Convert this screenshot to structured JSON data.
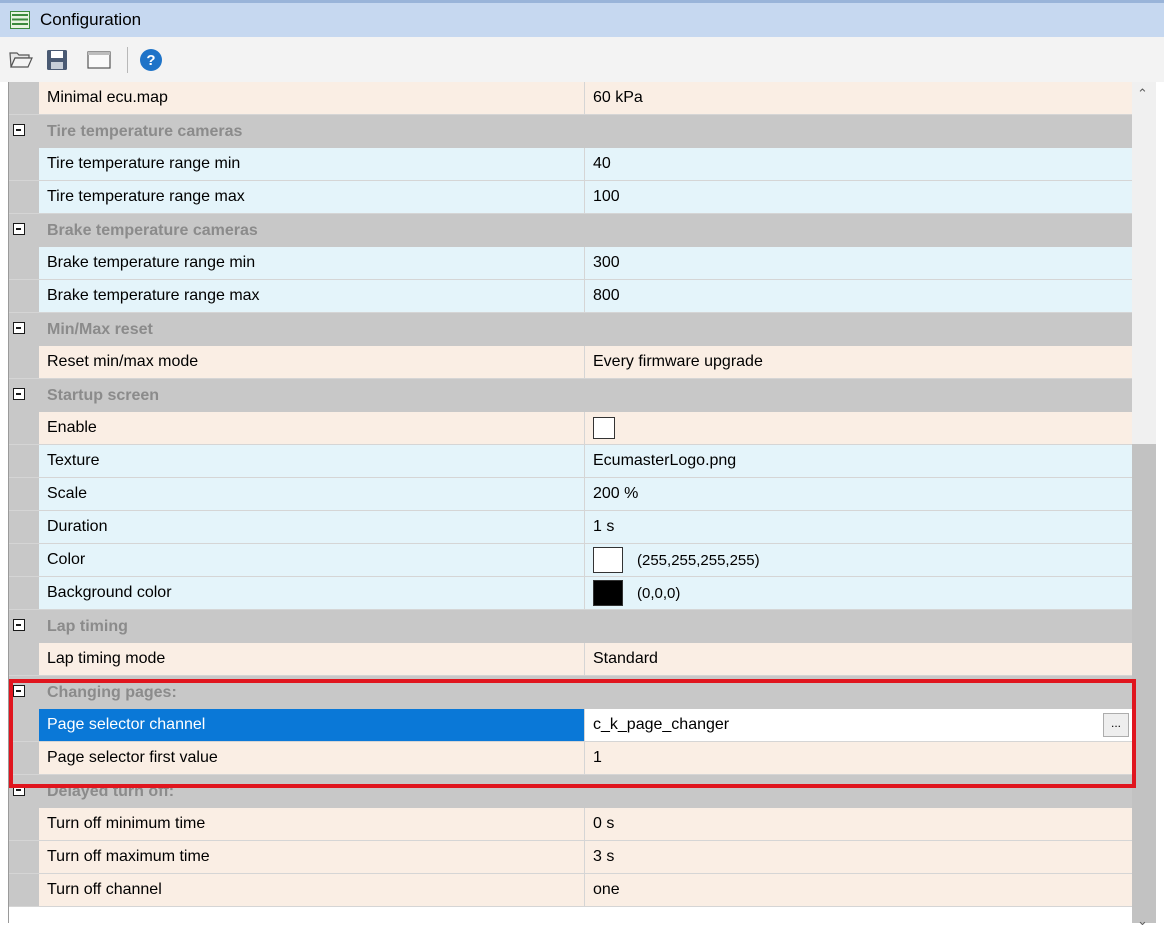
{
  "window": {
    "title": "Configuration"
  },
  "toolbar": {
    "buttons": [
      {
        "name": "open-folder-icon"
      },
      {
        "name": "save-icon"
      },
      {
        "name": "window-icon"
      },
      {
        "name": "help-icon"
      }
    ]
  },
  "grid": {
    "rows": [
      {
        "kind": "prop",
        "label": "Minimal ecu.map",
        "value": "60 kPa",
        "color": "peach"
      },
      {
        "kind": "cat",
        "label": "Tire temperature cameras"
      },
      {
        "kind": "prop",
        "label": "Tire temperature range min",
        "value": "40",
        "color": "blue"
      },
      {
        "kind": "prop",
        "label": "Tire temperature range max",
        "value": "100",
        "color": "blue"
      },
      {
        "kind": "cat",
        "label": "Brake temperature cameras"
      },
      {
        "kind": "prop",
        "label": "Brake temperature range min",
        "value": "300",
        "color": "blue"
      },
      {
        "kind": "prop",
        "label": "Brake temperature range max",
        "value": "800",
        "color": "blue"
      },
      {
        "kind": "cat",
        "label": "Min/Max reset"
      },
      {
        "kind": "prop",
        "label": "Reset min/max mode",
        "value": "Every firmware upgrade",
        "color": "peach"
      },
      {
        "kind": "cat",
        "label": "Startup screen"
      },
      {
        "kind": "prop",
        "label": "Enable",
        "value": "",
        "widget": "checkbox",
        "checked": false,
        "color": "peach"
      },
      {
        "kind": "prop",
        "label": "Texture",
        "value": "EcumasterLogo.png",
        "color": "blue"
      },
      {
        "kind": "prop",
        "label": "Scale",
        "value": "200 %",
        "color": "blue"
      },
      {
        "kind": "prop",
        "label": "Duration",
        "value": "1 s",
        "color": "blue"
      },
      {
        "kind": "prop",
        "label": "Color",
        "value": "(255,255,255,255)",
        "widget": "swatch",
        "swatch": "#ffffff",
        "color": "blue"
      },
      {
        "kind": "prop",
        "label": "Background color",
        "value": "(0,0,0)",
        "widget": "swatch",
        "swatch": "#000000",
        "color": "blue"
      },
      {
        "kind": "cat",
        "label": "Lap timing"
      },
      {
        "kind": "prop",
        "label": "Lap timing mode",
        "value": "Standard",
        "color": "peach"
      },
      {
        "kind": "cat",
        "label": "Changing pages:"
      },
      {
        "kind": "prop",
        "label": "Page selector channel",
        "value": "c_k_page_changer",
        "selected": true,
        "button": "...",
        "color": "peach"
      },
      {
        "kind": "prop",
        "label": "Page selector first value",
        "value": "1",
        "color": "peach"
      },
      {
        "kind": "cat",
        "label": "Delayed turn off:"
      },
      {
        "kind": "prop",
        "label": "Turn off minimum time",
        "value": "0 s",
        "color": "peach"
      },
      {
        "kind": "prop",
        "label": "Turn off maximum time",
        "value": "3 s",
        "color": "peach"
      },
      {
        "kind": "prop",
        "label": "Turn off channel",
        "value": "one",
        "color": "peach"
      }
    ]
  },
  "colors": {
    "category_bg": "#c8c8c8",
    "category_text": "#8b8b8b",
    "row_peach": "#faeee4",
    "row_blue": "#e4f4fa",
    "selection": "#0a78d7",
    "highlight": "#e0151e"
  }
}
